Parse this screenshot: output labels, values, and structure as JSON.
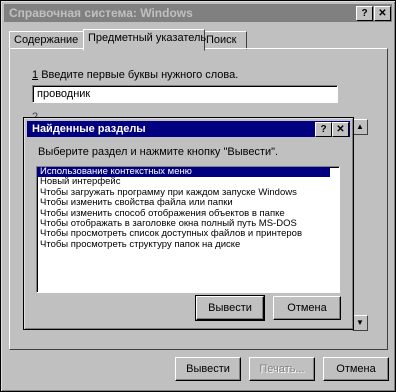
{
  "window": {
    "title": "Справочная система: Windows",
    "help_btn": "?",
    "close_btn": "✕"
  },
  "tabs": [
    {
      "label": "Содержание"
    },
    {
      "label": "Предметный указатель"
    },
    {
      "label": "Поиск"
    }
  ],
  "step1": {
    "number": "1",
    "text": "Введите первые буквы нужного слова.",
    "input_value": "проводник"
  },
  "step2_partial": "2",
  "dialog": {
    "title": "Найденные разделы",
    "help_btn": "?",
    "close_btn": "✕",
    "prompt": "Выберите раздел и нажмите кнопку \"Вывести\".",
    "items": [
      "Использование контекстных меню",
      "Новый интерфейс",
      "Чтобы загружать программу при каждом запуске Windows",
      "Чтобы изменить свойства файла или папки",
      "Чтобы изменить способ отображения объектов в папке",
      "Чтобы отображать в заголовке окна полный путь MS-DOS",
      "Чтобы просмотреть список доступных файлов и принтеров",
      "Чтобы просмотреть структуру папок на диске"
    ],
    "show_btn": "Вывести",
    "cancel_btn": "Отмена"
  },
  "footer": {
    "show_btn": "Вывести",
    "print_btn": "Печать...",
    "cancel_btn": "Отмена"
  }
}
